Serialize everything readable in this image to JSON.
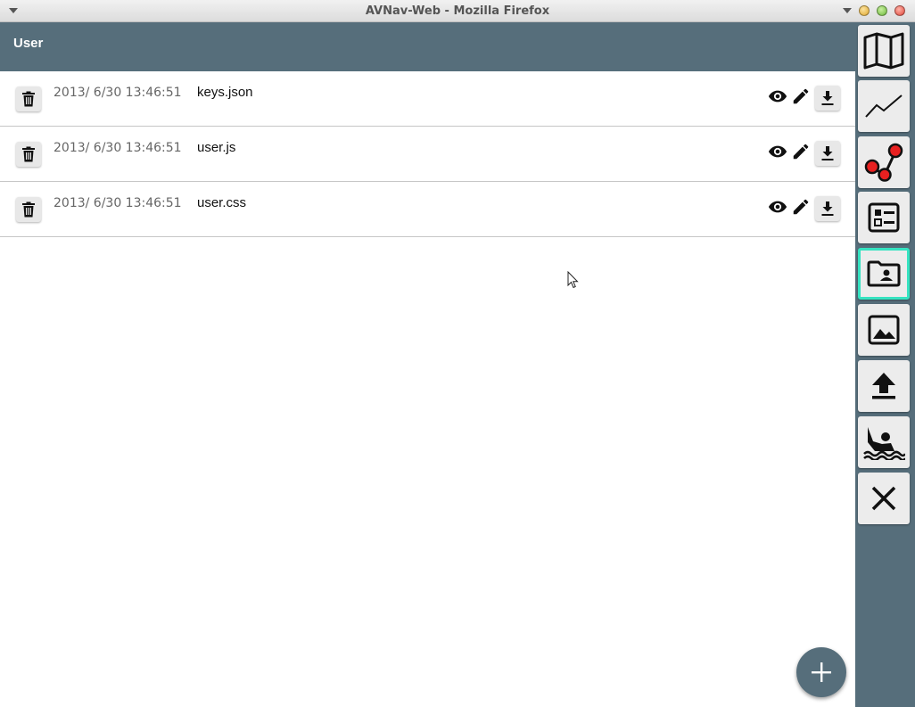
{
  "window": {
    "title": "AVNav-Web - Mozilla Firefox"
  },
  "header": {
    "title": "User"
  },
  "files": [
    {
      "date": "2013/ 6/30 13:46:51",
      "name": "keys.json"
    },
    {
      "date": "2013/ 6/30 13:46:51",
      "name": "user.js"
    },
    {
      "date": "2013/ 6/30 13:46:51",
      "name": "user.css"
    }
  ],
  "sidebar": {
    "items": [
      {
        "icon": "map-icon"
      },
      {
        "icon": "track-icon"
      },
      {
        "icon": "route-icon"
      },
      {
        "icon": "layout-icon"
      },
      {
        "icon": "user-folder-icon",
        "active": true
      },
      {
        "icon": "image-icon"
      },
      {
        "icon": "upload-icon"
      },
      {
        "icon": "mob-icon"
      },
      {
        "icon": "close-icon"
      }
    ]
  },
  "colors": {
    "header": "#566e7b",
    "active_border": "#35e3c1",
    "route_red": "#e82020"
  }
}
